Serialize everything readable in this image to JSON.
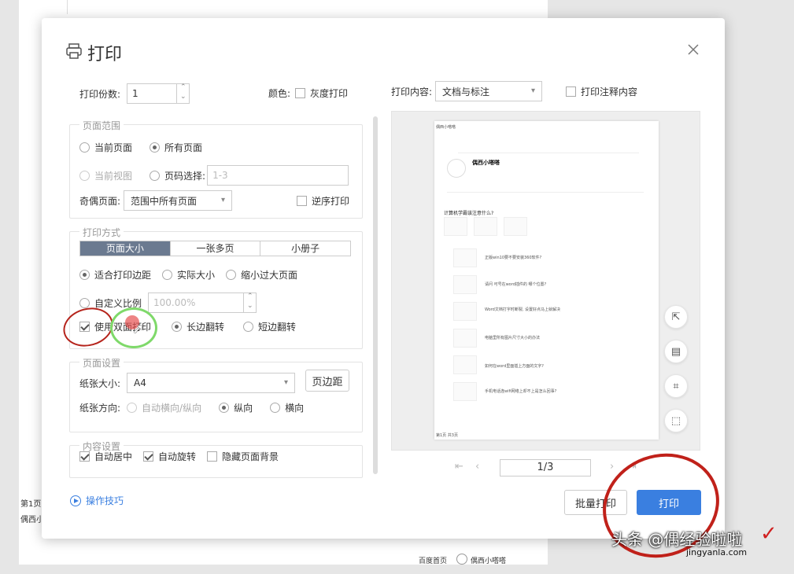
{
  "background": {
    "side_text_1": "第1页",
    "side_text_2": "偶西小",
    "bottom_text_1": "百度首页",
    "bottom_text_2": "偶西小嗒嗒"
  },
  "dialog": {
    "title": "打印",
    "copies_label": "打印份数:",
    "copies_value": "1",
    "color_label": "颜色:",
    "grayscale_label": "灰度打印",
    "page_range": {
      "title": "页面范围",
      "current_page": "当前页面",
      "all_pages": "所有页面",
      "current_view": "当前视图",
      "page_select": "页码选择:",
      "page_select_placeholder": "1-3",
      "odd_even_label": "奇偶页面:",
      "odd_even_value": "范围中所有页面",
      "reverse_print": "逆序打印"
    },
    "print_mode": {
      "title": "打印方式",
      "tabs": [
        "页面大小",
        "一张多页",
        "小册子"
      ],
      "fit_margins": "适合打印边距",
      "actual_size": "实际大小",
      "shrink_large": "缩小过大页面",
      "custom_scale": "自定义比例",
      "custom_scale_value": "100.00%",
      "duplex": "使用双面打印",
      "long_edge": "长边翻转",
      "short_edge": "短边翻转"
    },
    "page_setup": {
      "title": "页面设置",
      "paper_size_label": "纸张大小:",
      "paper_size_value": "A4",
      "margins_button": "页边距",
      "orientation_label": "纸张方向:",
      "auto_orientation": "自动横向/纵向",
      "portrait": "纵向",
      "landscape": "横向"
    },
    "content_setup": {
      "title": "内容设置",
      "auto_center": "自动居中",
      "auto_rotate": "自动旋转",
      "hide_background": "隐藏页面背景"
    },
    "tips_link": "操作技巧",
    "print_content_label": "打印内容:",
    "print_content_value": "文档与标注",
    "print_comments": "打印注释内容",
    "page_indicator": "1/3",
    "batch_print": "批量打印",
    "print_button": "打印"
  },
  "preview": {
    "header_left": "偶西小嗒嗒",
    "profile_name": "偶西小嗒嗒",
    "question": "计算机学霸该注意什么?",
    "items": [
      "正版win10要不要安装360软件?",
      "请问 可号在word插件的 哪个位置?",
      "Word文档打字时断裂, 设置好点马上就解决",
      "电脑里所有图片尺寸大小的办法",
      "如何在word里面插上方面的文字?",
      "手机电话连wifi网络上却不上是怎么回事?"
    ],
    "footer_left": "第1页 共3页"
  },
  "watermark": {
    "text": "头条 @偶经验啦啦",
    "url": "jingyanla.com"
  }
}
